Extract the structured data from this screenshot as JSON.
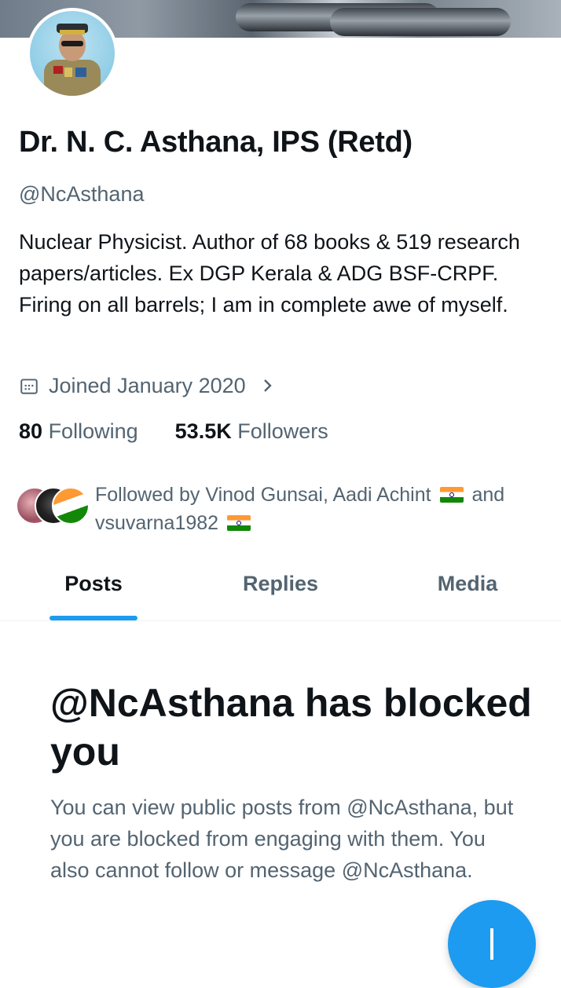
{
  "profile": {
    "name": "Dr. N. C. Asthana, IPS (Retd)",
    "handle": "@NcAsthana",
    "bio": "Nuclear Physicist. Author of 68 books & 519 research papers/articles. Ex DGP Kerala & ADG BSF-CRPF. Firing on all barrels; I am in complete awe of myself.",
    "joined": "Joined January 2020",
    "following_count": "80",
    "following_label": "Following",
    "followers_count": "53.5K",
    "followers_label": "Followers"
  },
  "followed_by": {
    "prefix": "Followed by Vinod Gunsai, Aadi Achint",
    "connector": "and",
    "last": "vsuvarna1982"
  },
  "tabs": [
    {
      "label": "Posts",
      "active": true
    },
    {
      "label": "Replies",
      "active": false
    },
    {
      "label": "Media",
      "active": false
    }
  ],
  "blocked": {
    "title": "@NcAsthana has blocked you",
    "message": "You can view public posts from @NcAsthana, but you are blocked from engaging with them. You also cannot follow or message @NcAsthana."
  },
  "icons": {
    "calendar": "calendar-icon",
    "chevron": "chevron-right-icon",
    "compose": "plus-icon",
    "flag": "india-flag-emoji"
  },
  "colors": {
    "accent": "#1d9bf0",
    "text_primary": "#0f1419",
    "text_secondary": "#536471"
  }
}
